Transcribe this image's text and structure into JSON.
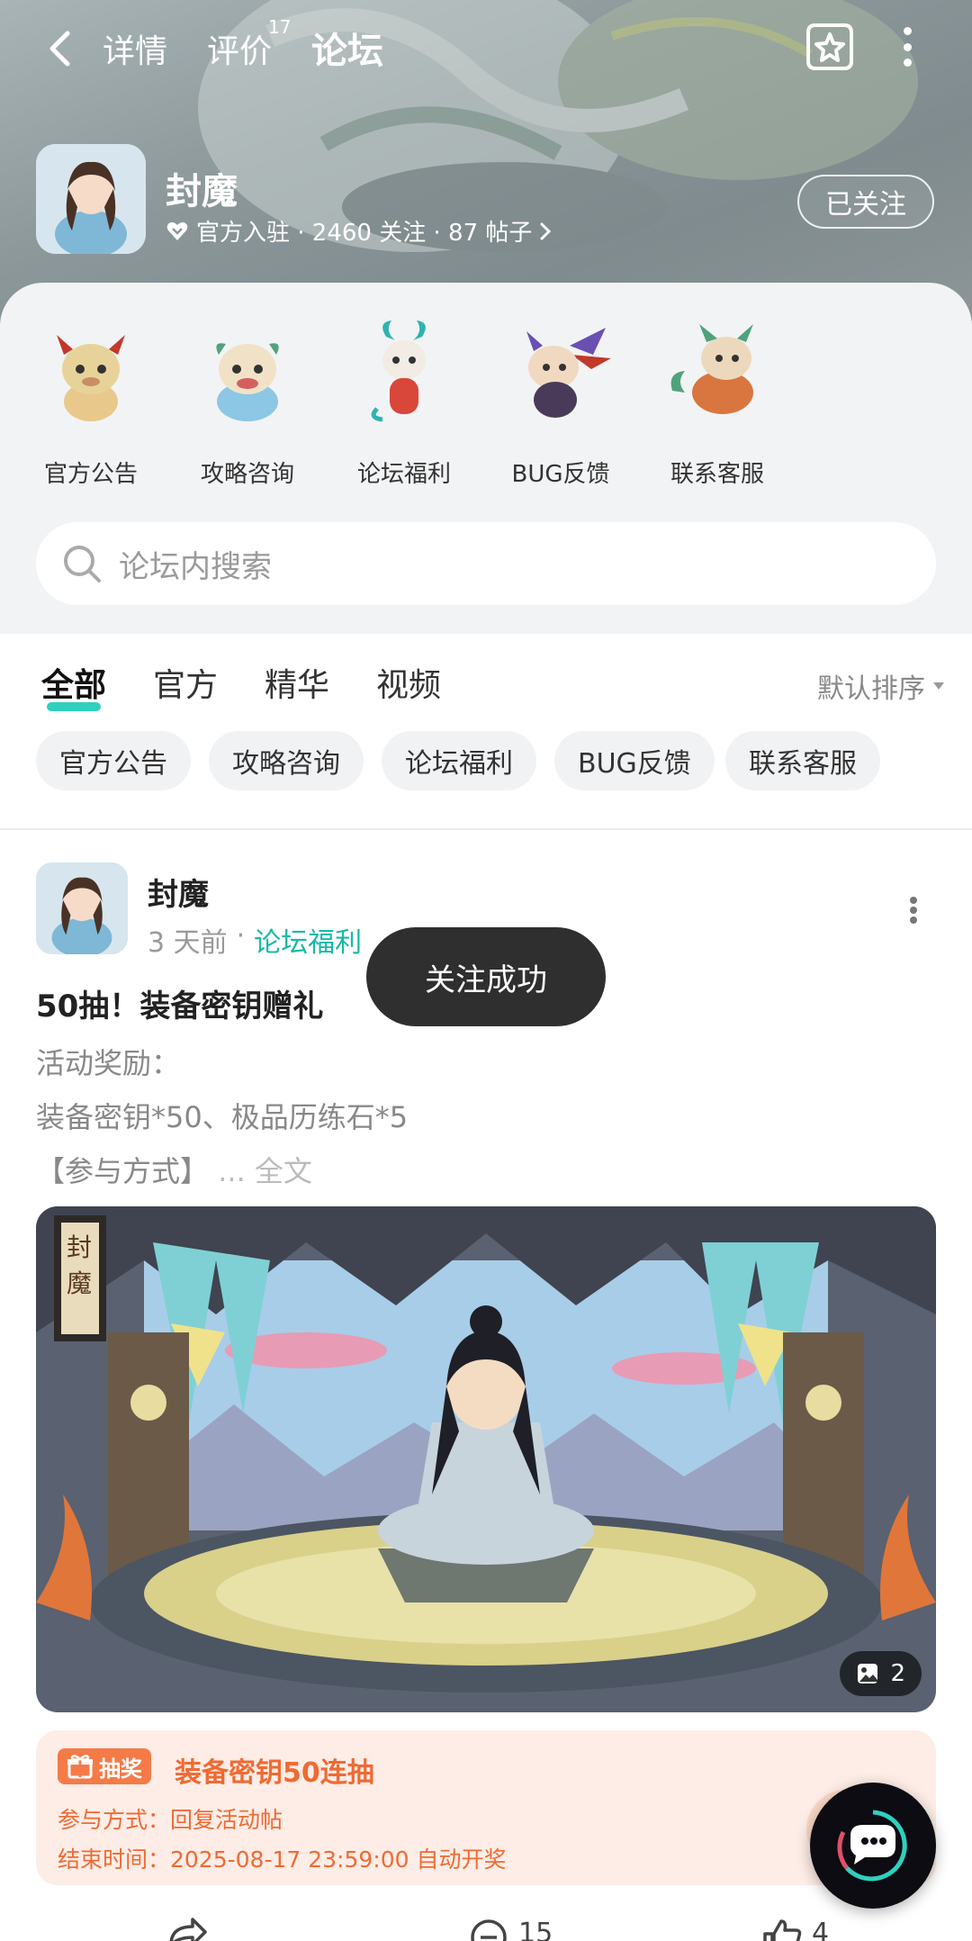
{
  "topbar": {
    "tabs": [
      {
        "label": "详情"
      },
      {
        "label": "评价",
        "badge": "17"
      },
      {
        "label": "论坛"
      }
    ],
    "accent": "#2fd0bd"
  },
  "forum": {
    "name": "封魔",
    "meta": "官方入驻 · 2460 关注 · 87 帖子",
    "follow_label": "已关注"
  },
  "entries": [
    {
      "label": "官方公告"
    },
    {
      "label": "攻略咨询"
    },
    {
      "label": "论坛福利"
    },
    {
      "label": "BUG反馈"
    },
    {
      "label": "联系客服"
    }
  ],
  "search": {
    "placeholder": "论坛内搜索"
  },
  "content_tabs": [
    {
      "label": "全部"
    },
    {
      "label": "官方"
    },
    {
      "label": "精华"
    },
    {
      "label": "视频"
    }
  ],
  "sort_label": "默认排序",
  "chips": [
    {
      "label": "官方公告"
    },
    {
      "label": "攻略咨询"
    },
    {
      "label": "论坛福利"
    },
    {
      "label": "BUG反馈"
    },
    {
      "label": "联系客服"
    }
  ],
  "post": {
    "author": "封魔",
    "time": "3 天前",
    "separator": "·",
    "category": "论坛福利",
    "title": "50抽！装备密钥赠礼",
    "lines": [
      "活动奖励：",
      "装备密钥*50、极品历练石*5",
      "【参与方式】"
    ],
    "full_text": "... 全文",
    "image_logo": "封魔",
    "image_count": "2",
    "lottery": {
      "tag": "抽奖",
      "title": "装备密钥50连抽",
      "line1": "参与方式：回复活动帖",
      "line2": "结束时间：2025-08-17 23:59:00 自动开奖"
    },
    "actions": {
      "comments": "15",
      "likes": "4"
    }
  },
  "toast": "关注成功"
}
